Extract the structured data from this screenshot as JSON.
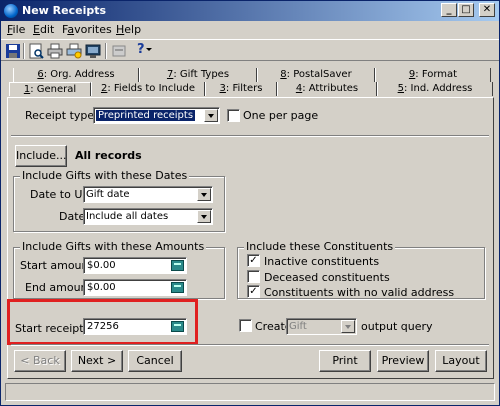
{
  "window": {
    "title": "New Receipts",
    "minimize": "_",
    "maximize": "□",
    "close": "✕"
  },
  "menu": {
    "file": {
      "label_u": "F",
      "label_rest": "ile"
    },
    "edit": {
      "label_u": "E",
      "label_rest": "dit"
    },
    "favorites": {
      "label_pre": "F",
      "label_u": "a",
      "label_rest": "vorites"
    },
    "help": {
      "label_u": "H",
      "label_rest": "elp"
    }
  },
  "toolbar": {
    "icons": [
      "save-icon",
      "preview-icon",
      "print-icon",
      "print-setup-icon",
      "export-icon",
      "properties-icon",
      "help-icon"
    ],
    "help_glyph": "?"
  },
  "tabs": {
    "back_row": [
      {
        "key": "6",
        "label": ": Org. Address"
      },
      {
        "key": "7",
        "label": ": Gift Types"
      },
      {
        "key": "8",
        "label": ": PostalSaver"
      },
      {
        "key": "9",
        "label": ": Format"
      }
    ],
    "front_row": [
      {
        "key": "1",
        "label": ": General"
      },
      {
        "key": "2",
        "label": ": Fields to Include"
      },
      {
        "key": "3",
        "label": ": Filters"
      },
      {
        "key": "4",
        "label": ": Attributes"
      },
      {
        "key": "5",
        "label": ": Ind. Address"
      }
    ]
  },
  "general": {
    "receipt_type_label": "Receipt type:",
    "receipt_type_value": "Preprinted receipts",
    "one_per_page_label": "One per page",
    "include_button": "Include...",
    "include_value": "All records",
    "dates_group_title": "Include Gifts with these Dates",
    "date_to_use_label": "Date to Use:",
    "date_to_use_value": "Gift date",
    "date_label": "Date:",
    "date_value": "Include all dates",
    "amounts_group_title": "Include Gifts with these Amounts",
    "start_amount_label": "Start amount:",
    "start_amount_value": "$0.00",
    "end_amount_label": "End amount:",
    "end_amount_value": "$0.00",
    "constituents_group_title": "Include these Constituents",
    "inactive_label": "Inactive constituents",
    "inactive_checked": true,
    "deceased_label": "Deceased constituents",
    "deceased_checked": false,
    "no_valid_address_label": "Constituents with no valid address",
    "no_valid_address_checked": true,
    "start_receipt_label": "Start receipt no.:",
    "start_receipt_value": "27256",
    "create_label": "Create",
    "create_type_value": "Gift",
    "output_query_label": "output query"
  },
  "buttons": {
    "back": "< Back",
    "next": "Next >",
    "cancel": "Cancel",
    "print": "Print",
    "preview": "Preview",
    "layout": "Layout"
  },
  "check_glyph": "✓"
}
